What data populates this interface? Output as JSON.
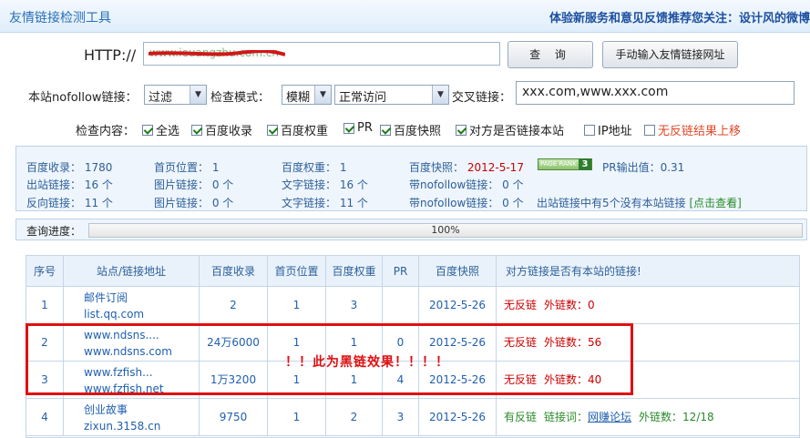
{
  "titlebar": {
    "title": "友情链接检测工具",
    "right_text": "体验新服务和意见反馈推荐您关注：设计风的微博"
  },
  "form": {
    "http_label": "HTTP://",
    "url_value": "www.ieuangzhu.com.cn",
    "query_button": "查 询",
    "manual_button": "手动输入友情链接网址",
    "nofollow_label": "本站nofollow链接：",
    "nofollow_value": "过滤",
    "mode_label": "检查模式：",
    "mode_value": "模糊",
    "access_value": "正常访问",
    "cross_label": "交叉链接：",
    "cross_value": "xxx.com,www.xxx.com",
    "check_label": "检查内容：",
    "checks": [
      {
        "label": "全选",
        "checked": true
      },
      {
        "label": "百度收录",
        "checked": true
      },
      {
        "label": "百度权重",
        "checked": true
      },
      {
        "label": "PR",
        "checked": true
      },
      {
        "label": "百度快照",
        "checked": true
      },
      {
        "label": "对方是否链接本站",
        "checked": true
      },
      {
        "label": "IP地址",
        "checked": false
      },
      {
        "label": "无反链结果上移",
        "checked": false
      }
    ]
  },
  "stats": {
    "baidu_index_label": "百度收录：",
    "baidu_index": "1780",
    "home_pos_label": "首页位置：",
    "home_pos": "1",
    "baidu_weight_label": "百度权重：",
    "baidu_weight": "1",
    "snapshot_label": "百度快照：",
    "snapshot": "2012-5-17",
    "pagerank_badge": "PAGE RANK",
    "pagerank_value": "3",
    "pr_output_label": "PR输出值：",
    "pr_output": "0.31",
    "outbound_label": "出站链接：",
    "outbound": "16 个",
    "image_links_label": "图片链接：",
    "image_links": "0 个",
    "text_links_label": "文字链接：",
    "text_links": "16 个",
    "nofollow_links_label": "带nofollow链接：",
    "nofollow_links": "0 个",
    "inbound_label": "反向链接：",
    "inbound": "11 个",
    "image_links2_label": "图片链接：",
    "image_links2": "0 个",
    "text_links2_label": "文字链接：",
    "text_links2": "11 个",
    "nofollow_links2_label": "带nofollow链接：",
    "nofollow_links2": "0 个",
    "notice": "出站链接中有5个没有本站链接",
    "notice_link": "[点击查看]"
  },
  "progress": {
    "label": "查询进度：",
    "percent": 100,
    "text": "100%"
  },
  "table": {
    "headers": [
      "序号",
      "站点/链接地址",
      "百度收录",
      "首页位置",
      "百度权重",
      "PR",
      "百度快照",
      "对方链接是否有本站的链接!"
    ],
    "rows": [
      {
        "no": "1",
        "name": "邮件订阅",
        "url": "list.qq.com",
        "index": "2",
        "home": "1",
        "weight": "3",
        "pr": "",
        "snapshot": "2012-5-26",
        "status": "无反链",
        "status_detail": "外链数：0"
      },
      {
        "no": "2",
        "name": "www.ndsns....",
        "url": "www.ndsns.com",
        "index": "24万6000",
        "home": "1",
        "weight": "1",
        "pr": "0",
        "snapshot": "2012-5-26",
        "status": "无反链",
        "status_detail": "外链数：56"
      },
      {
        "no": "3",
        "name": "www.fzfish...",
        "url": "www.fzfish.net",
        "index": "1万3200",
        "home": "1",
        "weight": "1",
        "pr": "4",
        "snapshot": "2012-5-26",
        "status": "无反链",
        "status_detail": "外链数：40"
      },
      {
        "no": "4",
        "name": "创业故事",
        "url": "zixun.3158.cn",
        "index": "9750",
        "home": "1",
        "weight": "2",
        "pr": "3",
        "snapshot": "2012-5-26",
        "status": "有反链",
        "status_detail": "链接词：",
        "link_word": "网赚论坛",
        "status_tail": "外链数：12/18"
      }
    ]
  },
  "annotation": "！！此为黑链效果！！！！"
}
